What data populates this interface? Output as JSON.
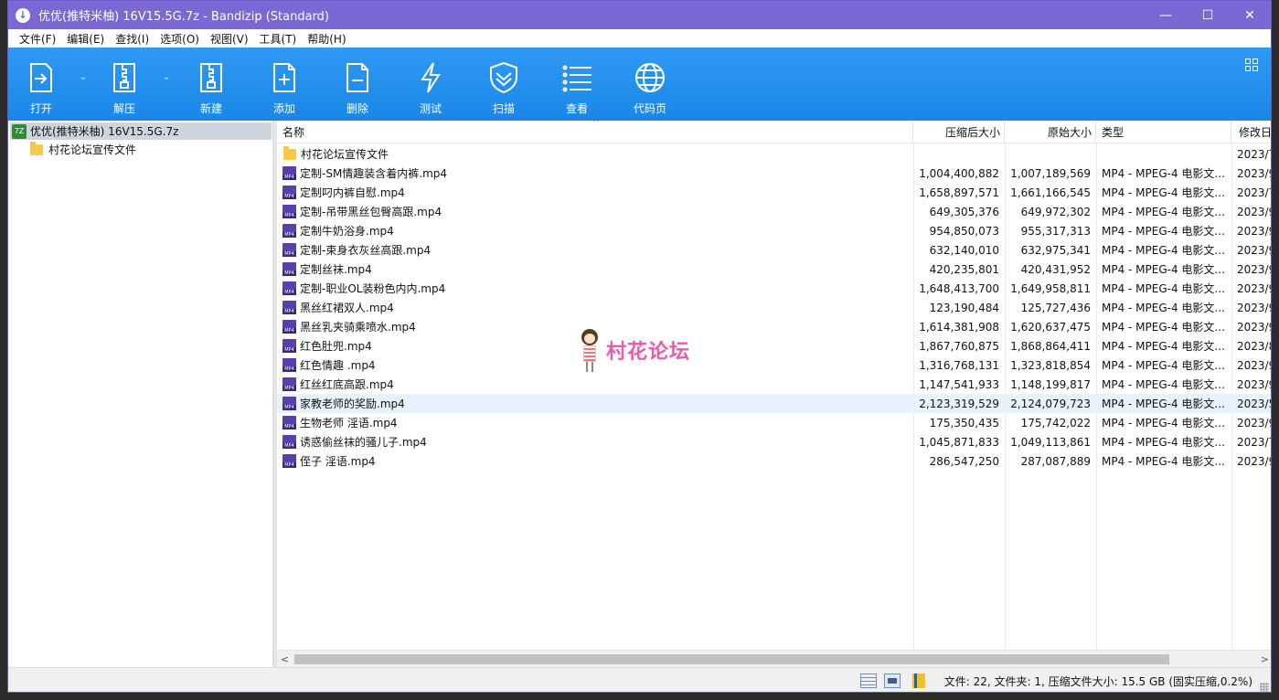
{
  "window": {
    "title": "优优(推特米柚) 16V15.5G.7z - Bandizip (Standard)",
    "controls": {
      "minimize": "—",
      "maximize": "☐",
      "close": "✕"
    }
  },
  "menu": [
    "文件(F)",
    "编辑(E)",
    "查找(I)",
    "选项(O)",
    "视图(V)",
    "工具(T)",
    "帮助(H)"
  ],
  "toolbar": {
    "open": "打开",
    "extract": "解压",
    "new": "新建",
    "add": "添加",
    "delete": "删除",
    "test": "测试",
    "scan": "扫描",
    "view": "查看",
    "codepage": "代码页",
    "dropdown": "⌄"
  },
  "tree": {
    "root": "优优(推特米柚) 16V15.5G.7z",
    "root_icon_text": "7Z",
    "child": "村花论坛宣传文件"
  },
  "columns": {
    "name": "名称",
    "packed": "压缩后大小",
    "original": "原始大小",
    "type": "类型",
    "modified": "修改日"
  },
  "sort_indicator": "^",
  "rows": [
    {
      "name": "村花论坛宣传文件",
      "packed": "",
      "original": "",
      "type": "",
      "date": "2023/7",
      "kind": "folder"
    },
    {
      "name": "定制-SM情趣装含着内裤.mp4",
      "packed": "1,004,400,882",
      "original": "1,007,189,569",
      "type": "MP4 - MPEG-4 电影文...",
      "date": "2023/9",
      "kind": "mp4"
    },
    {
      "name": "定制叼内裤自慰.mp4",
      "packed": "1,658,897,571",
      "original": "1,661,166,545",
      "type": "MP4 - MPEG-4 电影文...",
      "date": "2023/7",
      "kind": "mp4"
    },
    {
      "name": "定制-吊带黑丝包臀高跟.mp4",
      "packed": "649,305,376",
      "original": "649,972,302",
      "type": "MP4 - MPEG-4 电影文...",
      "date": "2023/9",
      "kind": "mp4"
    },
    {
      "name": "定制牛奶浴身.mp4",
      "packed": "954,850,073",
      "original": "955,317,313",
      "type": "MP4 - MPEG-4 电影文...",
      "date": "2023/9",
      "kind": "mp4"
    },
    {
      "name": "定制-束身衣灰丝高跟.mp4",
      "packed": "632,140,010",
      "original": "632,975,341",
      "type": "MP4 - MPEG-4 电影文...",
      "date": "2023/9",
      "kind": "mp4"
    },
    {
      "name": "定制丝袜.mp4",
      "packed": "420,235,801",
      "original": "420,431,952",
      "type": "MP4 - MPEG-4 电影文...",
      "date": "2023/9",
      "kind": "mp4"
    },
    {
      "name": "定制-职业OL装粉色内内.mp4",
      "packed": "1,648,413,700",
      "original": "1,649,958,811",
      "type": "MP4 - MPEG-4 电影文...",
      "date": "2023/9",
      "kind": "mp4"
    },
    {
      "name": "黑丝红裙双人.mp4",
      "packed": "123,190,484",
      "original": "125,727,436",
      "type": "MP4 - MPEG-4 电影文...",
      "date": "2023/9",
      "kind": "mp4"
    },
    {
      "name": "黑丝乳夹骑乘喷水.mp4",
      "packed": "1,614,381,908",
      "original": "1,620,637,475",
      "type": "MP4 - MPEG-4 电影文...",
      "date": "2023/9",
      "kind": "mp4"
    },
    {
      "name": "红色肚兜.mp4",
      "packed": "1,867,760,875",
      "original": "1,868,864,411",
      "type": "MP4 - MPEG-4 电影文...",
      "date": "2023/8",
      "kind": "mp4"
    },
    {
      "name": "红色情趣 .mp4",
      "packed": "1,316,768,131",
      "original": "1,323,818,854",
      "type": "MP4 - MPEG-4 电影文...",
      "date": "2023/9",
      "kind": "mp4"
    },
    {
      "name": "红丝红底高跟.mp4",
      "packed": "1,147,541,933",
      "original": "1,148,199,817",
      "type": "MP4 - MPEG-4 电影文...",
      "date": "2023/9",
      "kind": "mp4"
    },
    {
      "name": "家教老师的奖励.mp4",
      "packed": "2,123,319,529",
      "original": "2,124,079,723",
      "type": "MP4 - MPEG-4 电影文...",
      "date": "2023/5",
      "kind": "mp4",
      "selected": true
    },
    {
      "name": "生物老师 淫语.mp4",
      "packed": "175,350,435",
      "original": "175,742,022",
      "type": "MP4 - MPEG-4 电影文...",
      "date": "2023/9",
      "kind": "mp4"
    },
    {
      "name": "诱惑偷丝袜的骚儿子.mp4",
      "packed": "1,045,871,833",
      "original": "1,049,113,861",
      "type": "MP4 - MPEG-4 电影文...",
      "date": "2023/7",
      "kind": "mp4"
    },
    {
      "name": "侄子 淫语.mp4",
      "packed": "286,547,250",
      "original": "287,087,889",
      "type": "MP4 - MPEG-4 电影文...",
      "date": "2023/9",
      "kind": "mp4"
    }
  ],
  "watermark": "村花论坛",
  "scroll": {
    "left": "<",
    "right": ">"
  },
  "status": "文件: 22, 文件夹: 1, 压缩文件大小: 15.5 GB (固实压缩,0.2%)",
  "colors": {
    "titlebar": "#7b68d4",
    "toolbar": "#2491ee",
    "selected_row": "#e8f2fd"
  }
}
